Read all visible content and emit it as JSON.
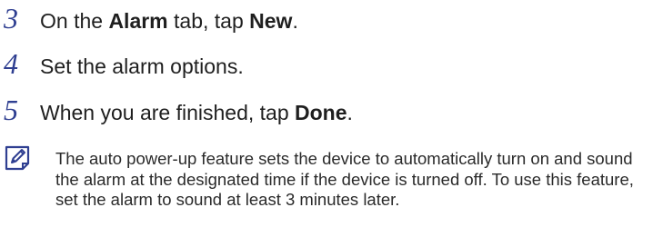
{
  "steps": [
    {
      "number": "3",
      "parts": [
        "On the ",
        "Alarm",
        " tab, tap ",
        "New",
        "."
      ]
    },
    {
      "number": "4",
      "text": "Set the alarm options."
    },
    {
      "number": "5",
      "parts": [
        "When you are finished, tap ",
        "Done",
        "."
      ]
    }
  ],
  "note": {
    "icon": "note-pencil-icon",
    "text": "The auto power-up feature sets the device to automatically turn on and sound the alarm at the designated time if the device is turned off. To use this feature, set the alarm to sound at least 3 minutes later."
  },
  "colors": {
    "step_number": "#2f3f91",
    "text": "#222222",
    "icon": "#2f3f91"
  }
}
